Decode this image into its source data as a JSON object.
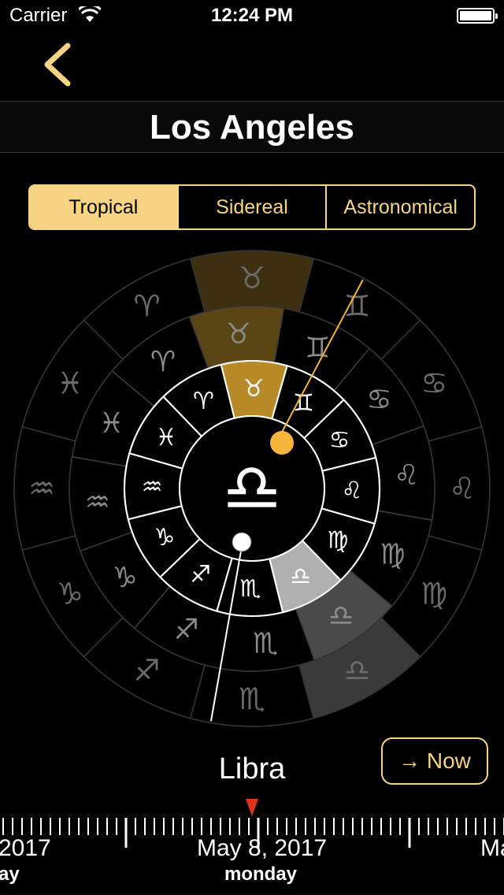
{
  "status": {
    "carrier": "Carrier",
    "time": "12:24 PM"
  },
  "nav": {
    "title": "Los Angeles"
  },
  "tabs": [
    {
      "label": "Tropical",
      "active": true
    },
    {
      "label": "Sidereal",
      "active": false
    },
    {
      "label": "Astronomical",
      "active": false
    }
  ],
  "wheel": {
    "center_symbol": "♎",
    "inner_ring": [
      "♈",
      "♉",
      "♊",
      "♋",
      "♌",
      "♍",
      "♎",
      "♏",
      "♐",
      "♑",
      "♒",
      "♓"
    ],
    "middle_ring": [
      "♈",
      "♉",
      "♊",
      "♋",
      "♌",
      "♍",
      "♎",
      "♏",
      "♐",
      "♑",
      "♒",
      "♓"
    ],
    "outer_ring": [
      "♈",
      "♉",
      "♊",
      "♋",
      "♌",
      "♍",
      "♎",
      "♏",
      "♐",
      "♑",
      "♒",
      "♓"
    ],
    "highlighted_gold": "♉",
    "highlighted_gray": "♎"
  },
  "current_sign": "Libra",
  "now_button": "→ Now",
  "timeline": {
    "prev_date": "2017",
    "prev_day": "ay",
    "current_date": "May 8, 2017",
    "current_day": "monday",
    "next_date": "Ma"
  },
  "colors": {
    "accent": "#f7d483",
    "gold": "#b88a28",
    "marker": "#f5b43a",
    "pointer": "#e0331c"
  }
}
